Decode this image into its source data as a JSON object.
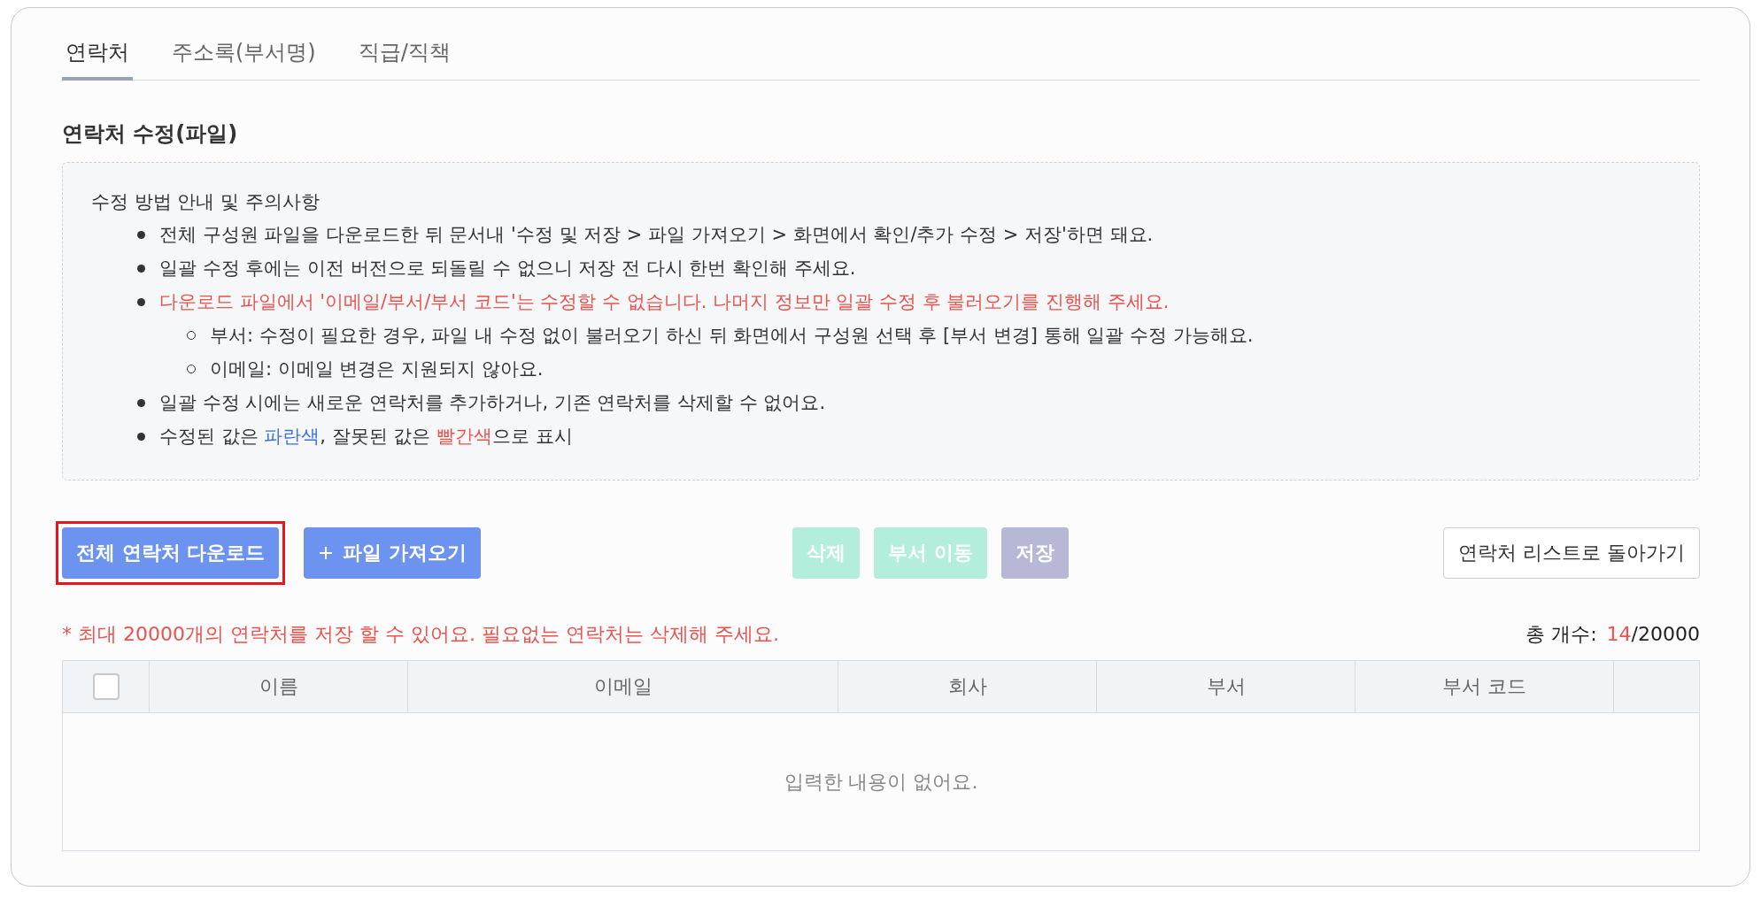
{
  "tabs": [
    {
      "label": "연락처",
      "selected": true
    },
    {
      "label": "주소록(부서명)",
      "selected": false
    },
    {
      "label": "직급/직책",
      "selected": false
    }
  ],
  "section_title": "연락처 수정(파일)",
  "notice": {
    "heading": "수정 방법 안내 및 주의사항",
    "items": [
      {
        "parts": [
          {
            "text": "전체 구성원 파일을 다운로드한 뒤 문서내 '수정 및 저장 > 파일 가져오기 > 화면에서 확인/추가 수정 > 저장'하면 돼요.",
            "color": "#333333"
          }
        ]
      },
      {
        "parts": [
          {
            "text": "일괄 수정 후에는 이전 버전으로 되돌릴 수 없으니 저장 전 다시 한번 확인해 주세요.",
            "color": "#333333"
          }
        ]
      },
      {
        "parts": [
          {
            "text": "다운로드 파일에서 '이메일/부서/부서 코드'는 수정할 수 없습니다. 나머지 정보만 일괄 수정 후 불러오기를 진행해 주세요.",
            "color": "#e8534d"
          }
        ],
        "children": [
          {
            "parts": [
              {
                "text": "부서: 수정이 필요한 경우, 파일 내 수정 없이 불러오기 하신 뒤 화면에서 구성원 선택 후 [부서 변경] 통해 일괄 수정 가능해요.",
                "color": "#333333"
              }
            ]
          },
          {
            "parts": [
              {
                "text": "이메일: 이메일 변경은 지원되지 않아요.",
                "color": "#333333"
              }
            ]
          }
        ]
      },
      {
        "parts": [
          {
            "text": "일괄 수정 시에는 새로운 연락처를 추가하거나, 기존 연락처를 삭제할 수 없어요.",
            "color": "#333333"
          }
        ]
      },
      {
        "parts": [
          {
            "text": "수정된 값은 ",
            "color": "#333333"
          },
          {
            "text": "파란색",
            "color": "#3f6fe0"
          },
          {
            "text": ", 잘못된 값은 ",
            "color": "#333333"
          },
          {
            "text": "빨간색",
            "color": "#e8534d"
          },
          {
            "text": "으로 표시",
            "color": "#333333"
          }
        ]
      }
    ]
  },
  "toolbar": {
    "left": [
      {
        "label": "전체 연락처 다운로드",
        "kind": "primary",
        "highlighted": true,
        "icon": false
      },
      {
        "label": "파일 가져오기",
        "kind": "primary",
        "highlighted": false,
        "icon": true
      }
    ],
    "center": [
      {
        "label": "삭제",
        "kind": "mint",
        "disabled": true
      },
      {
        "label": "부서 이동",
        "kind": "mint",
        "disabled": true
      },
      {
        "label": "저장",
        "kind": "purple",
        "disabled": true
      }
    ],
    "right": {
      "label": "연락처 리스트로 돌아가기"
    }
  },
  "limit_note": "* 최대 20000개의 연락처를 저장 할 수 있어요. 필요없는 연락처는 삭제해 주세요.",
  "count": {
    "label": "총 개수:",
    "current": "14",
    "max": "/20000"
  },
  "table": {
    "select_all": {
      "checked": false
    },
    "columns": [
      "이름",
      "이메일",
      "회사",
      "부서",
      "부서 코드"
    ],
    "empty_message": "입력한 내용이 없어요."
  }
}
